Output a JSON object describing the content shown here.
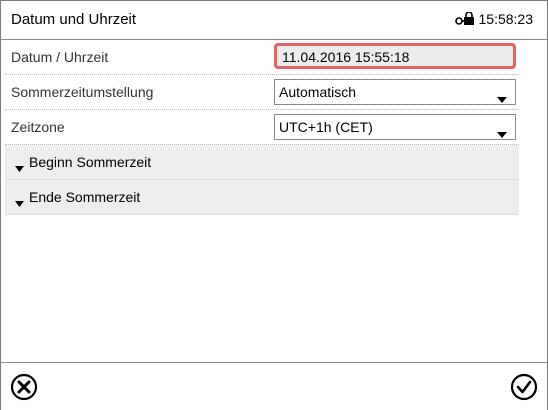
{
  "header": {
    "title": "Datum und Uhrzeit",
    "time": "15:58:23",
    "status_icon": "lock-key-icon"
  },
  "rows": {
    "datetime": {
      "label": "Datum / Uhrzeit",
      "value": "11.04.2016 15:55:18"
    },
    "dst": {
      "label": "Sommerzeitumstellung",
      "value": "Automatisch"
    },
    "timezone": {
      "label": "Zeitzone",
      "value": "UTC+1h (CET)"
    }
  },
  "sections": {
    "dst_start": "Beginn Sommerzeit",
    "dst_end": "Ende Sommerzeit"
  },
  "footer": {
    "cancel_icon": "close-circle-icon",
    "confirm_icon": "check-circle-icon"
  },
  "colors": {
    "highlight_border": "#e56363",
    "section_bg": "#ededed",
    "field_bg": "#ececec"
  }
}
